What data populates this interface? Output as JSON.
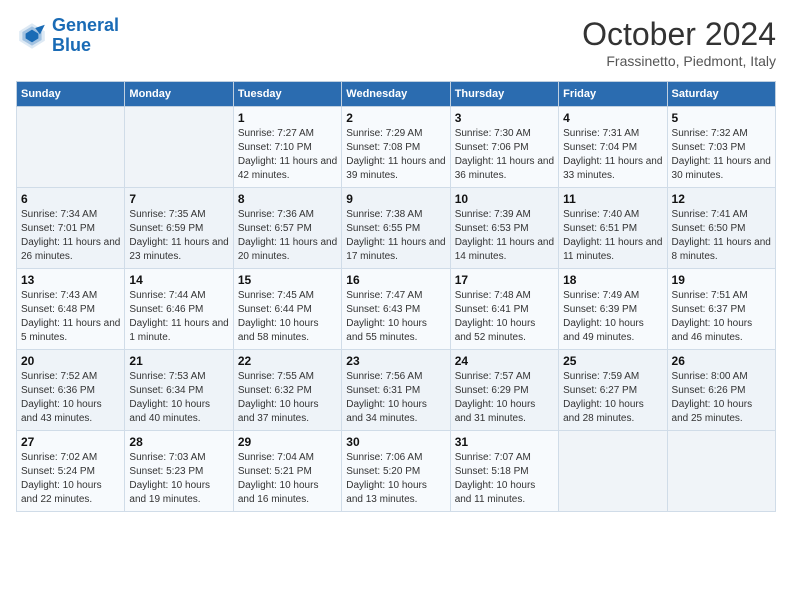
{
  "header": {
    "logo_line1": "General",
    "logo_line2": "Blue",
    "month": "October 2024",
    "location": "Frassinetto, Piedmont, Italy"
  },
  "weekdays": [
    "Sunday",
    "Monday",
    "Tuesday",
    "Wednesday",
    "Thursday",
    "Friday",
    "Saturday"
  ],
  "weeks": [
    [
      {
        "day": "",
        "info": ""
      },
      {
        "day": "",
        "info": ""
      },
      {
        "day": "1",
        "info": "Sunrise: 7:27 AM\nSunset: 7:10 PM\nDaylight: 11 hours and 42 minutes."
      },
      {
        "day": "2",
        "info": "Sunrise: 7:29 AM\nSunset: 7:08 PM\nDaylight: 11 hours and 39 minutes."
      },
      {
        "day": "3",
        "info": "Sunrise: 7:30 AM\nSunset: 7:06 PM\nDaylight: 11 hours and 36 minutes."
      },
      {
        "day": "4",
        "info": "Sunrise: 7:31 AM\nSunset: 7:04 PM\nDaylight: 11 hours and 33 minutes."
      },
      {
        "day": "5",
        "info": "Sunrise: 7:32 AM\nSunset: 7:03 PM\nDaylight: 11 hours and 30 minutes."
      }
    ],
    [
      {
        "day": "6",
        "info": "Sunrise: 7:34 AM\nSunset: 7:01 PM\nDaylight: 11 hours and 26 minutes."
      },
      {
        "day": "7",
        "info": "Sunrise: 7:35 AM\nSunset: 6:59 PM\nDaylight: 11 hours and 23 minutes."
      },
      {
        "day": "8",
        "info": "Sunrise: 7:36 AM\nSunset: 6:57 PM\nDaylight: 11 hours and 20 minutes."
      },
      {
        "day": "9",
        "info": "Sunrise: 7:38 AM\nSunset: 6:55 PM\nDaylight: 11 hours and 17 minutes."
      },
      {
        "day": "10",
        "info": "Sunrise: 7:39 AM\nSunset: 6:53 PM\nDaylight: 11 hours and 14 minutes."
      },
      {
        "day": "11",
        "info": "Sunrise: 7:40 AM\nSunset: 6:51 PM\nDaylight: 11 hours and 11 minutes."
      },
      {
        "day": "12",
        "info": "Sunrise: 7:41 AM\nSunset: 6:50 PM\nDaylight: 11 hours and 8 minutes."
      }
    ],
    [
      {
        "day": "13",
        "info": "Sunrise: 7:43 AM\nSunset: 6:48 PM\nDaylight: 11 hours and 5 minutes."
      },
      {
        "day": "14",
        "info": "Sunrise: 7:44 AM\nSunset: 6:46 PM\nDaylight: 11 hours and 1 minute."
      },
      {
        "day": "15",
        "info": "Sunrise: 7:45 AM\nSunset: 6:44 PM\nDaylight: 10 hours and 58 minutes."
      },
      {
        "day": "16",
        "info": "Sunrise: 7:47 AM\nSunset: 6:43 PM\nDaylight: 10 hours and 55 minutes."
      },
      {
        "day": "17",
        "info": "Sunrise: 7:48 AM\nSunset: 6:41 PM\nDaylight: 10 hours and 52 minutes."
      },
      {
        "day": "18",
        "info": "Sunrise: 7:49 AM\nSunset: 6:39 PM\nDaylight: 10 hours and 49 minutes."
      },
      {
        "day": "19",
        "info": "Sunrise: 7:51 AM\nSunset: 6:37 PM\nDaylight: 10 hours and 46 minutes."
      }
    ],
    [
      {
        "day": "20",
        "info": "Sunrise: 7:52 AM\nSunset: 6:36 PM\nDaylight: 10 hours and 43 minutes."
      },
      {
        "day": "21",
        "info": "Sunrise: 7:53 AM\nSunset: 6:34 PM\nDaylight: 10 hours and 40 minutes."
      },
      {
        "day": "22",
        "info": "Sunrise: 7:55 AM\nSunset: 6:32 PM\nDaylight: 10 hours and 37 minutes."
      },
      {
        "day": "23",
        "info": "Sunrise: 7:56 AM\nSunset: 6:31 PM\nDaylight: 10 hours and 34 minutes."
      },
      {
        "day": "24",
        "info": "Sunrise: 7:57 AM\nSunset: 6:29 PM\nDaylight: 10 hours and 31 minutes."
      },
      {
        "day": "25",
        "info": "Sunrise: 7:59 AM\nSunset: 6:27 PM\nDaylight: 10 hours and 28 minutes."
      },
      {
        "day": "26",
        "info": "Sunrise: 8:00 AM\nSunset: 6:26 PM\nDaylight: 10 hours and 25 minutes."
      }
    ],
    [
      {
        "day": "27",
        "info": "Sunrise: 7:02 AM\nSunset: 5:24 PM\nDaylight: 10 hours and 22 minutes."
      },
      {
        "day": "28",
        "info": "Sunrise: 7:03 AM\nSunset: 5:23 PM\nDaylight: 10 hours and 19 minutes."
      },
      {
        "day": "29",
        "info": "Sunrise: 7:04 AM\nSunset: 5:21 PM\nDaylight: 10 hours and 16 minutes."
      },
      {
        "day": "30",
        "info": "Sunrise: 7:06 AM\nSunset: 5:20 PM\nDaylight: 10 hours and 13 minutes."
      },
      {
        "day": "31",
        "info": "Sunrise: 7:07 AM\nSunset: 5:18 PM\nDaylight: 10 hours and 11 minutes."
      },
      {
        "day": "",
        "info": ""
      },
      {
        "day": "",
        "info": ""
      }
    ]
  ]
}
